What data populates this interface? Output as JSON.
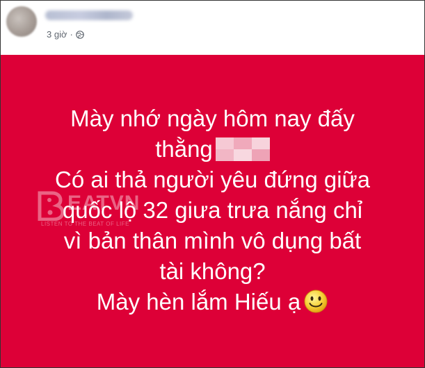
{
  "post": {
    "author_name": "",
    "timestamp": "3 giờ",
    "separator": "·",
    "audience_icon": "globe-icon",
    "background_color": "#dd0037",
    "text_color": "#ffffff",
    "lines": [
      "Mày nhớ ngày hôm nay đấy",
      "thằng",
      "Có ai thả người yêu đứng giữa",
      "quốc lộ 32 giưa trưa nắng chỉ",
      "vì bản thân mình vô dụng bất",
      "tài không?",
      "Mày hèn lắm Hiếu ạ"
    ],
    "censored_icon": "pixelated-censor",
    "emoji_icon": "smile-icon"
  },
  "watermark": {
    "brand": "EATVN",
    "tagline": "LISTEN TO THE BEAT OF LIFE"
  }
}
